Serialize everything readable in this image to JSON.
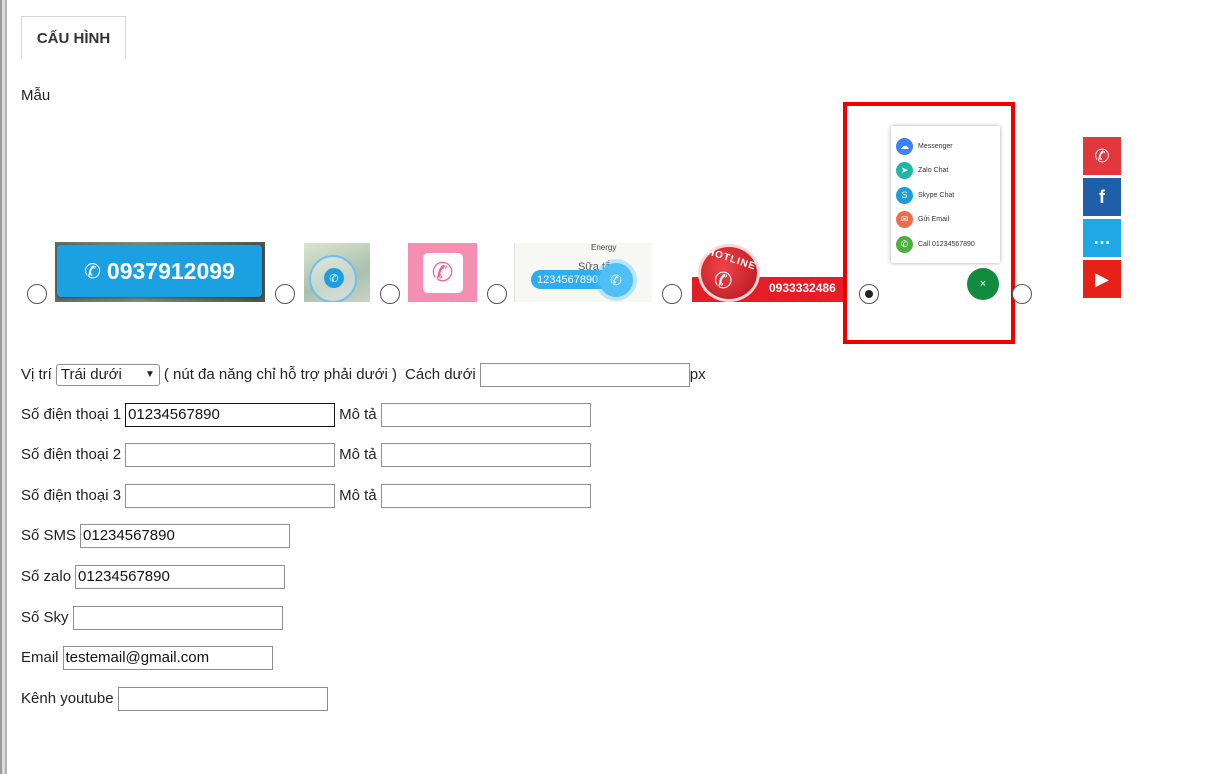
{
  "tab": {
    "label": "CẤU HÌNH"
  },
  "templates": {
    "label": "Mẫu",
    "t1_phone": "0937912099",
    "t4_brand": "Energy",
    "t4_product": "Sữa tắm Energy",
    "t4_phone": "1234567890",
    "t5_hotline": "HOTLINE",
    "t5_phone": "0933332486",
    "t6_menu": {
      "messenger": "Messenger",
      "zalo": "Zalo Chat",
      "skype": "Skype Chat",
      "email": "Gửi Email",
      "call": "Call 01234567890"
    },
    "selected": 6,
    "colors": {
      "highlight": "#e00000",
      "messenger": "#3a82f7",
      "zalo": "#1fb6a6",
      "skype": "#1d9cd8",
      "email": "#ef6c4a",
      "call": "#4cb040",
      "close": "#118c3f"
    }
  },
  "form": {
    "position_label": "Vị trí",
    "position_value": "Trái dưới",
    "position_note": "( nút đa năng chỉ hỗ trợ phải dưới )",
    "bottom_label": "Cách dưới",
    "bottom_value": "",
    "bottom_unit": "px",
    "phone1_label": "Số điện thoại 1",
    "phone1_value": "01234567890",
    "phone2_label": "Số điện thoại 2",
    "phone2_value": "",
    "phone3_label": "Số điện thoại 3",
    "phone3_value": "",
    "desc_label": "Mô tả",
    "sms_label": "Số SMS",
    "sms_value": "01234567890",
    "zalo_label": "Số zalo",
    "zalo_value": "01234567890",
    "sky_label": "Số Sky",
    "sky_value": "",
    "email_label": "Email",
    "email_value": "testemail@gmail.com",
    "youtube_label": "Kênh youtube",
    "youtube_value": ""
  }
}
